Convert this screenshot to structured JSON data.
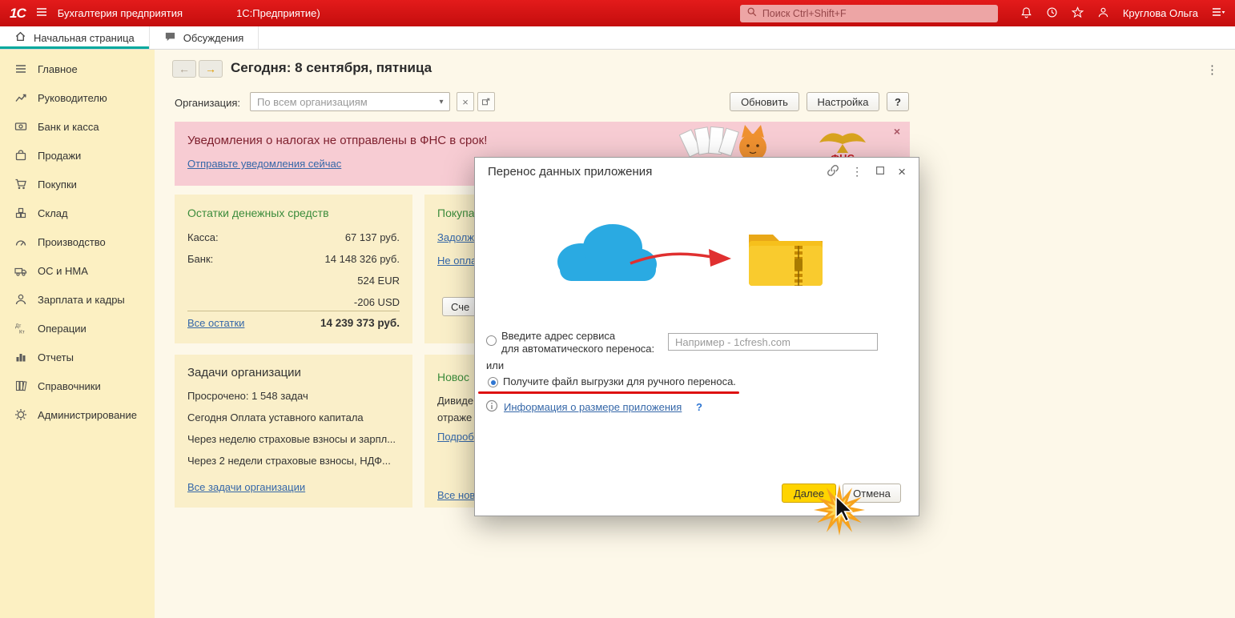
{
  "colors": {
    "topbar_red": "#d21414",
    "accent_teal": "#00a99d",
    "sidebar_yellow": "#fcf0c2",
    "card_yellow": "#faefc9",
    "banner_pink": "#f7ccd3",
    "link_blue": "#3567a8",
    "highlight_yellow": "#ffd400",
    "annotation_red": "#dd1111"
  },
  "icons": {
    "back_arrow": "←",
    "forward_arrow": "→",
    "kebab": "⋮",
    "dropdown_arrow": "▾",
    "close": "×",
    "dtkt_top": "Дт",
    "dtkt_bottom": "Кт"
  },
  "topbar": {
    "logo": "1С",
    "app_title": "Бухгалтерия предприятия",
    "platform_title": "1С:Предприятие)",
    "search_placeholder": "Поиск Ctrl+Shift+F",
    "user_name": "Круглова Ольга"
  },
  "tabs": {
    "home": "Начальная страница",
    "discussions": "Обсуждения"
  },
  "sidebar": {
    "items": [
      {
        "label": "Главное"
      },
      {
        "label": "Руководителю"
      },
      {
        "label": "Банк и касса"
      },
      {
        "label": "Продажи"
      },
      {
        "label": "Покупки"
      },
      {
        "label": "Склад"
      },
      {
        "label": "Производство"
      },
      {
        "label": "ОС и НМА"
      },
      {
        "label": "Зарплата и кадры"
      },
      {
        "label": "Операции"
      },
      {
        "label": "Отчеты"
      },
      {
        "label": "Справочники"
      },
      {
        "label": "Администрирование"
      }
    ]
  },
  "main": {
    "date_title": "Сегодня: 8 сентября, пятница",
    "org_label": "Организация:",
    "org_placeholder": "По всем организациям",
    "refresh_button": "Обновить",
    "settings_button": "Настройка",
    "help_button": "?"
  },
  "banner": {
    "title": "Уведомления о налогах не отправлены в ФНС в срок!",
    "link": "Отправьте уведомления сейчас",
    "fns_label": "ФНС"
  },
  "cash_card": {
    "title": "Остатки денежных средств",
    "rows": [
      {
        "label": "Касса:",
        "value": "67 137 руб."
      },
      {
        "label": "Банк:",
        "value": "14 148 326 руб."
      },
      {
        "label": "",
        "value": "524 EUR"
      },
      {
        "label": "",
        "value": "-206 USD"
      }
    ],
    "all_link": "Все остатки",
    "total": "14 239 373 руб."
  },
  "purchases_card": {
    "title": "Покупа",
    "link1": "Задолж",
    "link2": "Не опла",
    "button": "Сче"
  },
  "tasks_card": {
    "title": "Задачи организации",
    "rows": [
      "Просрочено: 1 548 задач",
      "Сегодня Оплата уставного капитала",
      "Через неделю страховые взносы и зарпл...",
      "Через 2 недели страховые взносы, НДФ..."
    ],
    "all_link": "Все задачи организации"
  },
  "news_card": {
    "title": "Новос",
    "row1": "Дивиде",
    "row2": "отраже",
    "more_link": "Подроб",
    "all_link": "Все нов"
  },
  "dialog": {
    "title": "Перенос данных приложения",
    "radio1_line1": "Введите адрес сервиса",
    "radio1_line2": "для автоматического переноса:",
    "input_placeholder": "Например - 1cfresh.com",
    "or_label": "или",
    "radio2_label": "Получите файл выгрузки для ручного переноса.",
    "info_link": "Информация о размере приложения",
    "info_help": "?",
    "next_button": "Далее",
    "cancel_button": "Отмена"
  }
}
